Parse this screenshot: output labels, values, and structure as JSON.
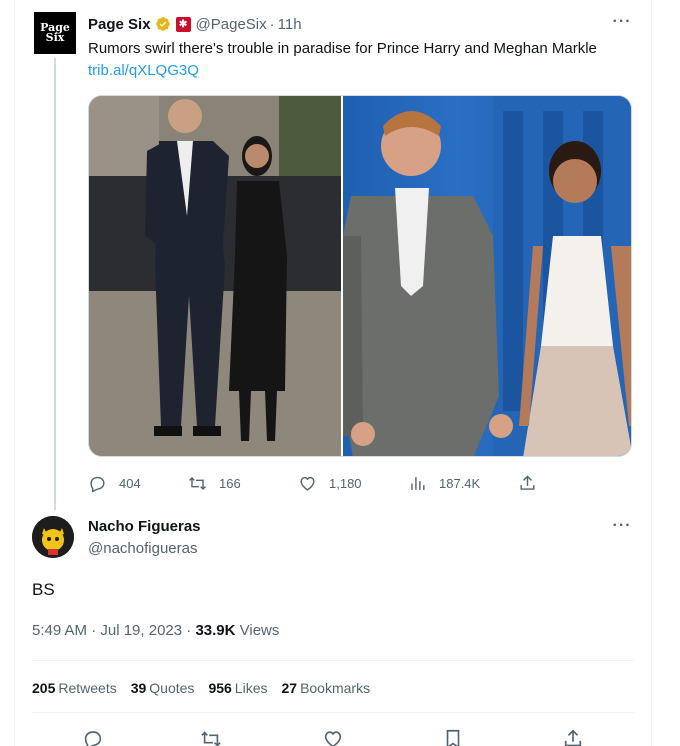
{
  "tweet": {
    "author_name": "Page Six",
    "author_handle": "@PageSix",
    "separator": "·",
    "time_ago": "11h",
    "avatar_text": "Page Six",
    "text": "Rumors swirl there's trouble in paradise for Prince Harry and Meghan Markle",
    "link": "trib.al/qXLQG3Q",
    "replies": "404",
    "retweets": "166",
    "likes": "1,180",
    "views": "187.4K"
  },
  "reply": {
    "author_name": "Nacho Figueras",
    "author_handle": "@nachofigueras",
    "text": "BS",
    "datetime": "5:49 AM · Jul 19, 2023 · ",
    "views_count": "33.9K",
    "views_label": " Views",
    "stats": [
      {
        "count": "205",
        "label": "Retweets"
      },
      {
        "count": "39",
        "label": "Quotes"
      },
      {
        "count": "956",
        "label": "Likes"
      },
      {
        "count": "27",
        "label": "Bookmarks"
      }
    ]
  },
  "colors": {
    "link": "#1d9bf0",
    "muted": "#536471",
    "verified_gold": "#e2b719",
    "affiliate_red": "#c8102e"
  },
  "icons": [
    "more-icon",
    "verified-badge-icon",
    "affiliate-badge-icon",
    "reply-icon",
    "retweet-icon",
    "like-icon",
    "views-icon",
    "share-icon",
    "bookmark-icon"
  ]
}
